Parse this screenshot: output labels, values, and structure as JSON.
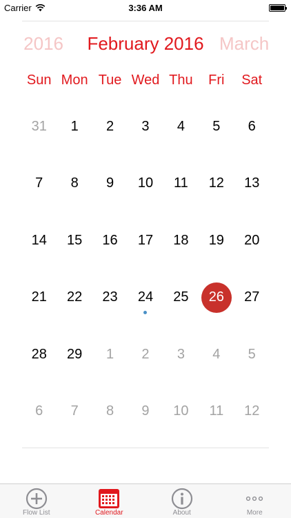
{
  "status_bar": {
    "carrier": "Carrier",
    "time": "3:36 AM"
  },
  "month_header": {
    "prev": "y 2016",
    "current": "February 2016",
    "next": "March"
  },
  "weekdays": [
    "Sun",
    "Mon",
    "Tue",
    "Wed",
    "Thu",
    "Fri",
    "Sat"
  ],
  "weeks": [
    [
      "31",
      "1",
      "2",
      "3",
      "4",
      "5",
      "6"
    ],
    [
      "7",
      "8",
      "9",
      "10",
      "11",
      "12",
      "13"
    ],
    [
      "14",
      "15",
      "16",
      "17",
      "18",
      "19",
      "20"
    ],
    [
      "21",
      "22",
      "23",
      "24",
      "25",
      "26",
      "27"
    ],
    [
      "28",
      "29",
      "1",
      "2",
      "3",
      "4",
      "5"
    ],
    [
      "6",
      "7",
      "8",
      "9",
      "10",
      "11",
      "12"
    ]
  ],
  "tabs": [
    {
      "label": "Flow List",
      "icon": "plus-circle-icon"
    },
    {
      "label": "Calendar",
      "icon": "calendar-icon"
    },
    {
      "label": "About",
      "icon": "info-circle-icon"
    },
    {
      "label": "More",
      "icon": "more-icon"
    }
  ],
  "colors": {
    "accent": "#e1191e",
    "selected": "#c8312b",
    "event_dot": "#4a90c6",
    "muted": "#a3a3a3"
  }
}
